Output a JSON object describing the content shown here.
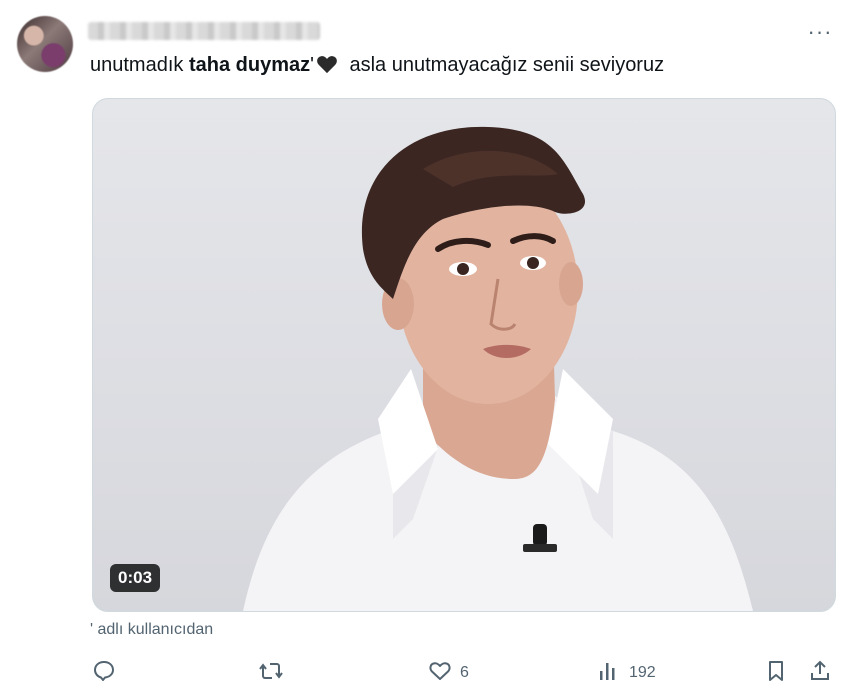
{
  "tweet": {
    "text_before": "unutmadık ",
    "mention": "taha duymaz",
    "apostrophe": "'",
    "text_after": " asla unutmayacağız senii seviyoruz",
    "more_label": "···"
  },
  "media": {
    "duration": "0:03"
  },
  "caption": "' adlı kullanıcıdan",
  "actions": {
    "replies": "",
    "retweets": "",
    "likes": "6",
    "views": "192"
  },
  "colors": {
    "text": "#0f1419",
    "muted": "#536471",
    "heart": "#2b2b2b"
  },
  "icons": [
    "avatar",
    "more-icon",
    "black-heart-icon",
    "reply-icon",
    "retweet-icon",
    "like-icon",
    "views-icon",
    "bookmark-icon",
    "share-icon"
  ]
}
